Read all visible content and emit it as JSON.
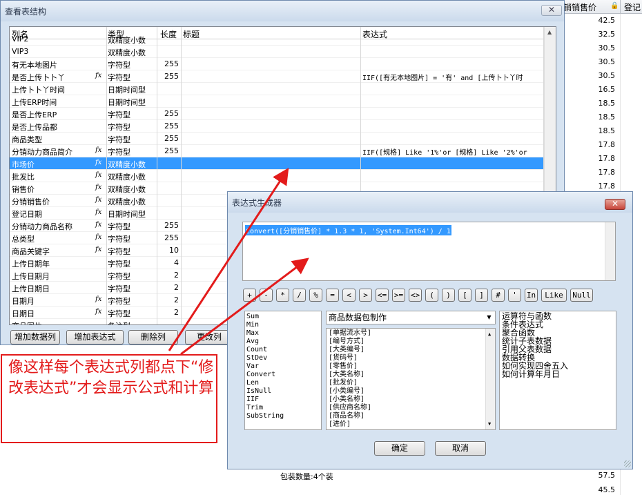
{
  "background_sheet": {
    "col1_header": "销销售价",
    "col2_header": "登记",
    "values": [
      "42.5",
      "32.5",
      "30.5",
      "30.5",
      "30.5",
      "16.5",
      "18.5",
      "18.5",
      "18.5",
      "17.8",
      "17.8",
      "17.8",
      "17.8"
    ],
    "bottom_values": [
      "57.5",
      "45.5"
    ],
    "footer_text": "包装数量:4个装"
  },
  "window1": {
    "title": "查看表结构",
    "close_label": "✕",
    "columns": [
      "列名",
      "类型",
      "长度",
      "标题",
      "表达式"
    ],
    "rows": [
      {
        "name": "VIP2",
        "fx": false,
        "type": "双精度小数",
        "len": "",
        "expr": ""
      },
      {
        "name": "VIP3",
        "fx": false,
        "type": "双精度小数",
        "len": "",
        "expr": ""
      },
      {
        "name": "有无本地图片",
        "fx": false,
        "type": "字符型",
        "len": "255",
        "expr": ""
      },
      {
        "name": "是否上传卜卜丫",
        "fx": true,
        "type": "字符型",
        "len": "255",
        "expr": "IIF([有无本地图片] = '有' and [上传卜卜丫时"
      },
      {
        "name": "上传卜卜丫时间",
        "fx": false,
        "type": "日期时间型",
        "len": "",
        "expr": ""
      },
      {
        "name": "上传ERP时间",
        "fx": false,
        "type": "日期时间型",
        "len": "",
        "expr": ""
      },
      {
        "name": "是否上传ERP",
        "fx": false,
        "type": "字符型",
        "len": "255",
        "expr": ""
      },
      {
        "name": "是否上传品都",
        "fx": false,
        "type": "字符型",
        "len": "255",
        "expr": ""
      },
      {
        "name": "商品类型",
        "fx": false,
        "type": "字符型",
        "len": "255",
        "expr": ""
      },
      {
        "name": "分销动力商品简介",
        "fx": true,
        "type": "字符型",
        "len": "255",
        "expr": "IIF([规格] Like '1%'or [规格] Like '2%'or"
      },
      {
        "name": "市场价",
        "fx": true,
        "type": "双精度小数",
        "len": "",
        "expr": ""
      },
      {
        "name": "批发比",
        "fx": true,
        "type": "双精度小数",
        "len": "",
        "expr": ""
      },
      {
        "name": "销售价",
        "fx": true,
        "type": "双精度小数",
        "len": "",
        "expr": ""
      },
      {
        "name": "分销销售价",
        "fx": true,
        "type": "双精度小数",
        "len": "",
        "expr": ""
      },
      {
        "name": "登记日期",
        "fx": true,
        "type": "日期时间型",
        "len": "",
        "expr": ""
      },
      {
        "name": "分销动力商品名称",
        "fx": true,
        "type": "字符型",
        "len": "255",
        "expr": ""
      },
      {
        "name": "总类型",
        "fx": true,
        "type": "字符型",
        "len": "255",
        "expr": ""
      },
      {
        "name": "商品关键字",
        "fx": true,
        "type": "字符型",
        "len": "10",
        "expr": ""
      },
      {
        "name": "上传日期年",
        "fx": false,
        "type": "字符型",
        "len": "4",
        "expr": ""
      },
      {
        "name": "上传日期月",
        "fx": false,
        "type": "字符型",
        "len": "2",
        "expr": ""
      },
      {
        "name": "上传日期日",
        "fx": false,
        "type": "字符型",
        "len": "2",
        "expr": ""
      },
      {
        "name": "日期月",
        "fx": true,
        "type": "字符型",
        "len": "2",
        "expr": ""
      },
      {
        "name": "日期日",
        "fx": true,
        "type": "字符型",
        "len": "2",
        "expr": ""
      },
      {
        "name": "商品图片",
        "fx": false,
        "type": "备注型",
        "len": "",
        "expr": ""
      }
    ],
    "selected_row_index": 10,
    "buttons": [
      "增加数据列",
      "增加表达式",
      "删除列",
      "更改列"
    ]
  },
  "window2": {
    "title": "表达式生成器",
    "close_label": "✕",
    "expression": "Convert([分销销售价] * 1.3 * 1, 'System.Int64') / 1",
    "operators": [
      "+",
      "-",
      "*",
      "/",
      "%",
      "=",
      "<",
      ">",
      "<=",
      ">=",
      "<>",
      "(",
      ")",
      "[",
      "]",
      "#",
      "'",
      "In",
      "Like",
      "Null"
    ],
    "functions": [
      "Sum",
      "Min",
      "Max",
      "Avg",
      "Count",
      "StDev",
      "Var",
      "Convert",
      "Len",
      "IsNull",
      "IIF",
      "Trim",
      "SubString"
    ],
    "table_select": "商品数据包制作",
    "fields": [
      "[单据流水号]",
      "[编号方式]",
      "[大类编号]",
      "[货码号]",
      "[零售价]",
      "[大类名称]",
      "[批发价]",
      "[小类编号]",
      "[小类名称]",
      "[供应商名称]",
      "[商品名称]",
      "[进价]"
    ],
    "help_topics": [
      "运算符与函数",
      "条件表达式",
      "聚合函数",
      "统计子表数据",
      "引用父表数据",
      "数据转换",
      "如何实现四舍五入",
      "如何计算年月日"
    ],
    "ok_label": "确定",
    "cancel_label": "取消"
  },
  "annotation": {
    "text": "像这样每个表达式列都点下“修改表达式”才会显示公式和计算",
    "color": "#e31b1b"
  },
  "colors": {
    "window_bg": "#d6e3f1",
    "selection": "#3399ff",
    "annotation": "#e31b1b"
  }
}
